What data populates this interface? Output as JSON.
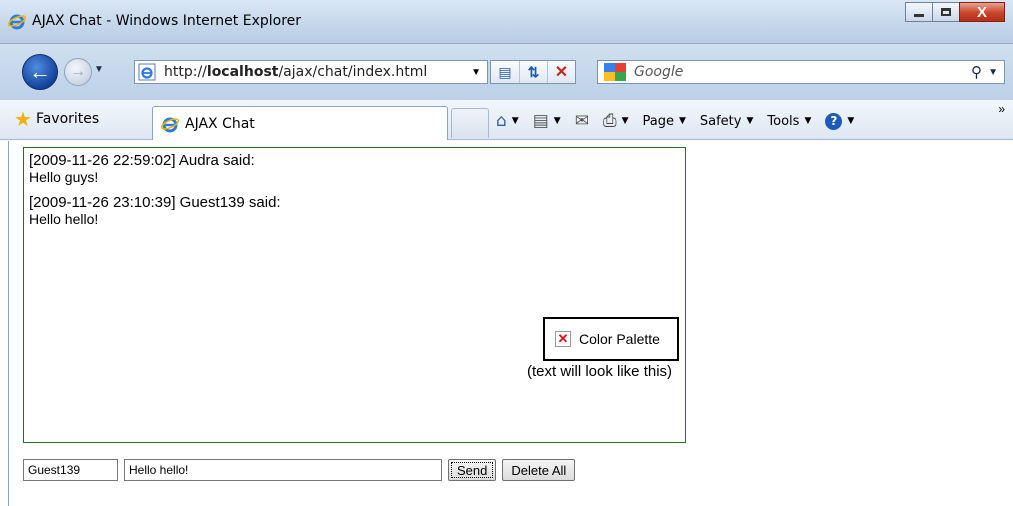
{
  "window": {
    "title": "AJAX Chat - Windows Internet Explorer",
    "controls": {
      "minimize": "minimize",
      "maximize": "maximize",
      "close": "X"
    }
  },
  "address_bar": {
    "url_prefix": "http://",
    "url_host": "localhost",
    "url_path": "/ajax/chat/index.html",
    "search_placeholder": "Google"
  },
  "favorites_bar": {
    "favorites_label": "Favorites",
    "tab_title": "AJAX Chat",
    "commands": {
      "page": "Page",
      "safety": "Safety",
      "tools": "Tools"
    }
  },
  "chat": {
    "messages": [
      {
        "header": "[2009-11-26 22:59:02] Audra said:",
        "body": "Hello guys!"
      },
      {
        "header": "[2009-11-26 23:10:39] Guest139 said:",
        "body": "Hello hello!"
      }
    ],
    "palette_label": "Color Palette",
    "preview_text": "(text will look like this)"
  },
  "form": {
    "name_value": "Guest139",
    "message_value": "Hello hello!",
    "send_label": "Send",
    "delete_label": "Delete All"
  },
  "colors": {
    "chat_border": "#2e6b2e",
    "chrome_blue": "#c4d6ea",
    "close_red": "#c8442a"
  }
}
